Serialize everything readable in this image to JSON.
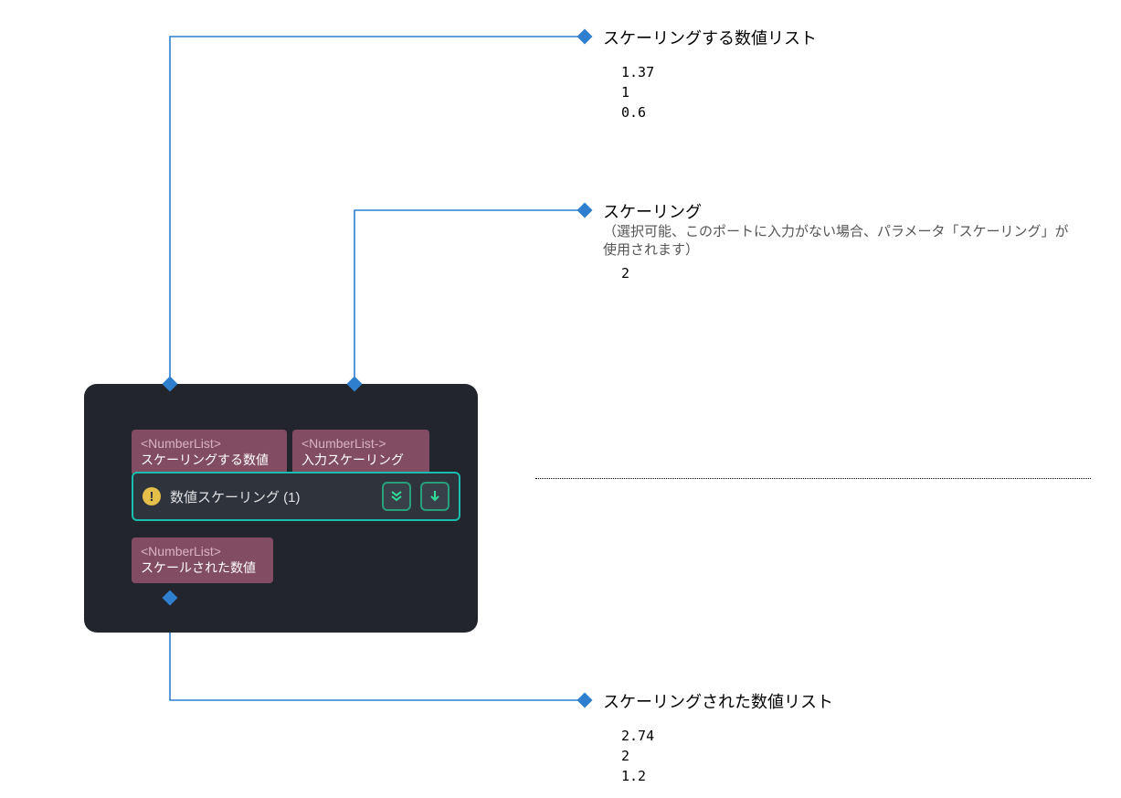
{
  "node": {
    "ports": {
      "in1": {
        "type": "<NumberList>",
        "label": "スケーリングする数値"
      },
      "in2": {
        "type": "<NumberList->",
        "label": "入力スケーリング"
      },
      "out": {
        "type": "<NumberList>",
        "label": "スケールされた数値"
      }
    },
    "title": "数値スケーリング (1)"
  },
  "annotations": {
    "input_list": {
      "title": "スケーリングする数値リスト",
      "values": [
        "1.37",
        "1",
        "0.6"
      ]
    },
    "scaling": {
      "title": "スケーリング",
      "note": "（選択可能、このポートに入力がない場合、パラメータ「スケーリング」が使用されます）",
      "value": "2"
    },
    "output_list": {
      "title": "スケーリングされた数値リスト",
      "values": [
        "2.74",
        "2",
        "1.2"
      ]
    }
  }
}
